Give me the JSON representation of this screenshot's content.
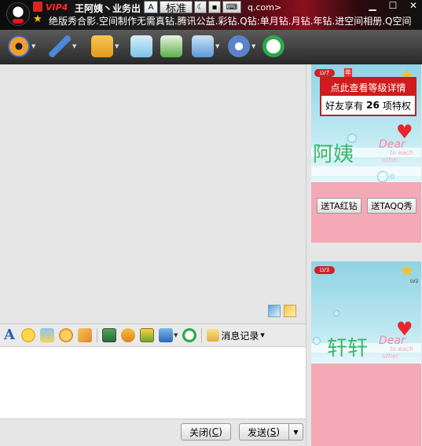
{
  "title_bar": {
    "vip_label": "VIP4",
    "contact_name": "王阿姨丶业务出",
    "signature": "绝版秀合影.空间制作无需真钻.腾讯公益.彩钻.Q钻:单月钻.月钻.年钻.进空间相册.Q空间",
    "font_button_label": "标准",
    "email_fragment": "q.com>",
    "window_controls": [
      "minimize-icon",
      "maximize-icon",
      "close-icon"
    ]
  },
  "toolbar": {
    "items": [
      {
        "name": "video-call-icon",
        "color": "#f0a030"
      },
      {
        "name": "voice-call-icon",
        "color": "#4a88d8"
      },
      {
        "name": "send-file-icon",
        "color": "#f2b23a"
      },
      {
        "name": "email-icon",
        "color": "#7cc4e8"
      },
      {
        "name": "create-group-icon",
        "color": "#5ab04c"
      },
      {
        "name": "remote-assist-icon",
        "color": "#5a9ad8"
      },
      {
        "name": "app-settings-icon",
        "color": "#5a84c8"
      },
      {
        "name": "soso-icon",
        "color": "#2ca84a"
      }
    ]
  },
  "input_toolbar": {
    "history_label": "消息记录",
    "icons": [
      "font-icon",
      "emoticon-icon",
      "magic-emoticon-icon",
      "shake-icon",
      "scrawl-icon",
      "screenshot-icon",
      "music-icon",
      "gift-icon",
      "screen-share-icon",
      "soso-icon"
    ]
  },
  "buttons": {
    "close_label": "关闭(",
    "close_hotkey": "C",
    "close_suffix": ")",
    "send_label": "发送(",
    "send_hotkey": "S",
    "send_suffix": ")"
  },
  "right_panel": {
    "show1": {
      "level": "LV7",
      "year_badge": "年",
      "popup_title": "点此查看等级详情",
      "popup_text_prefix": "好友享有",
      "popup_count": "26",
      "popup_text_suffix": "项特权",
      "name": "阿姨",
      "dear": "Dear",
      "dear_sub1": "to each",
      "dear_sub2": "other",
      "btn_red_diamond": "送TA红钻",
      "btn_qq_show": "送TAQQ秀"
    },
    "show2": {
      "level": "LV3",
      "level_right": "LV2",
      "name": "轩轩",
      "dear": "Dear",
      "dear_sub1": "to each",
      "dear_sub2": "other"
    }
  },
  "colors": {
    "accent_red": "#d01c1c",
    "panel_pink": "#f4a9b7",
    "panel_blue": "#8fd3e4",
    "name_green": "#38b86a"
  }
}
